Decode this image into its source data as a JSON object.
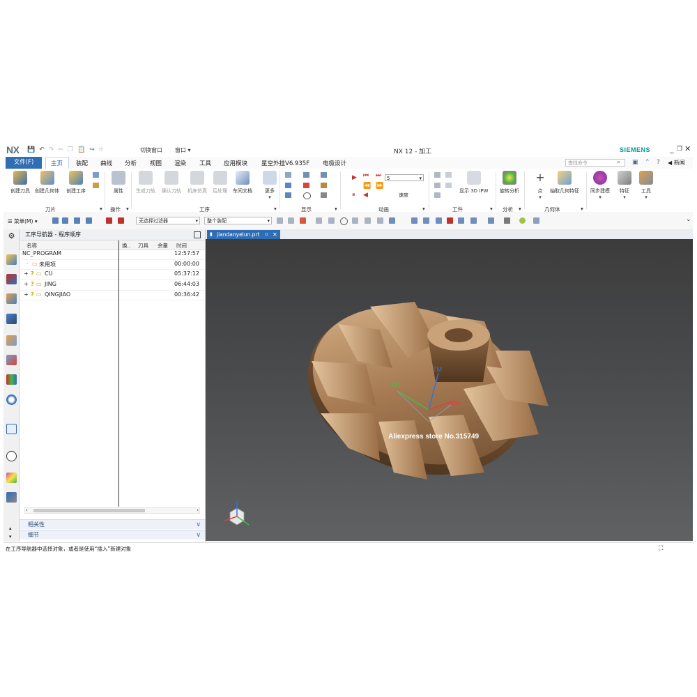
{
  "app": {
    "logo": "NX",
    "window_title": "NX 12 - 加工",
    "brand": "SIEMENS",
    "qa_switch_window": "切换窗口",
    "qa_window": "窗口"
  },
  "menu": {
    "file": "文件(F)",
    "items": [
      "主页",
      "装配",
      "曲线",
      "分析",
      "视图",
      "渲染",
      "工具",
      "应用模块",
      "星空外挂V6.935F",
      "电极设计"
    ],
    "search_placeholder": "查找命令",
    "news": "新闻"
  },
  "ribbon": {
    "tools_group": {
      "label": "刀片",
      "buttons": [
        "创建刀具",
        "创建几何体",
        "创建工序"
      ]
    },
    "ops_group": {
      "label": "操作",
      "buttons": [
        "属性"
      ]
    },
    "proc_group": {
      "label": "工序",
      "buttons": [
        "生成刀轨",
        "确认刀轨",
        "机床仿真",
        "后处理",
        "车间文档",
        "更多"
      ]
    },
    "display_group": {
      "label": "显示"
    },
    "anim_group": {
      "label": "动画",
      "speed_value": "5",
      "speed_label": "速度"
    },
    "work_group": {
      "label": "工件",
      "buttons": [
        "显示 3D IPW"
      ]
    },
    "analysis_group": {
      "label": "分析",
      "buttons": [
        "旋转分析"
      ]
    },
    "geom_group": {
      "label": "几何体",
      "buttons": [
        "点",
        "抽取几何特征"
      ]
    },
    "extra_buttons": [
      "同步建模",
      "特征",
      "工具"
    ]
  },
  "toolbar": {
    "menu_label": "菜单(M)",
    "filter_select": "无选择过滤器",
    "assembly_select": "整个装配"
  },
  "navigator": {
    "title": "工序导航器 - 程序顺序",
    "columns": [
      "名称",
      "换..",
      "刀具",
      "余量",
      "时间"
    ],
    "rows": [
      {
        "name": "NC_PROGRAM",
        "time": "12:57:57"
      },
      {
        "name": "未用项",
        "time": "00:00:00"
      },
      {
        "name": "CU",
        "time": "05:37:12"
      },
      {
        "name": "JING",
        "time": "06:44:03"
      },
      {
        "name": "QINGJIAO",
        "time": "00:36:42"
      }
    ],
    "panel_related": "相关性",
    "panel_detail": "细节"
  },
  "document": {
    "tab": "jiandanyelun.prt",
    "watermark": "Aliexpress store No.315749",
    "axis_y": "YM",
    "axis_z": "ZM",
    "axis_x": "XM"
  },
  "status": {
    "message": "在工序导航器中选择对象，或者是使用“插入”新建对象"
  },
  "colors": {
    "accent": "#2f6db5",
    "brand": "#009999",
    "part_bronze": "#b08862"
  }
}
